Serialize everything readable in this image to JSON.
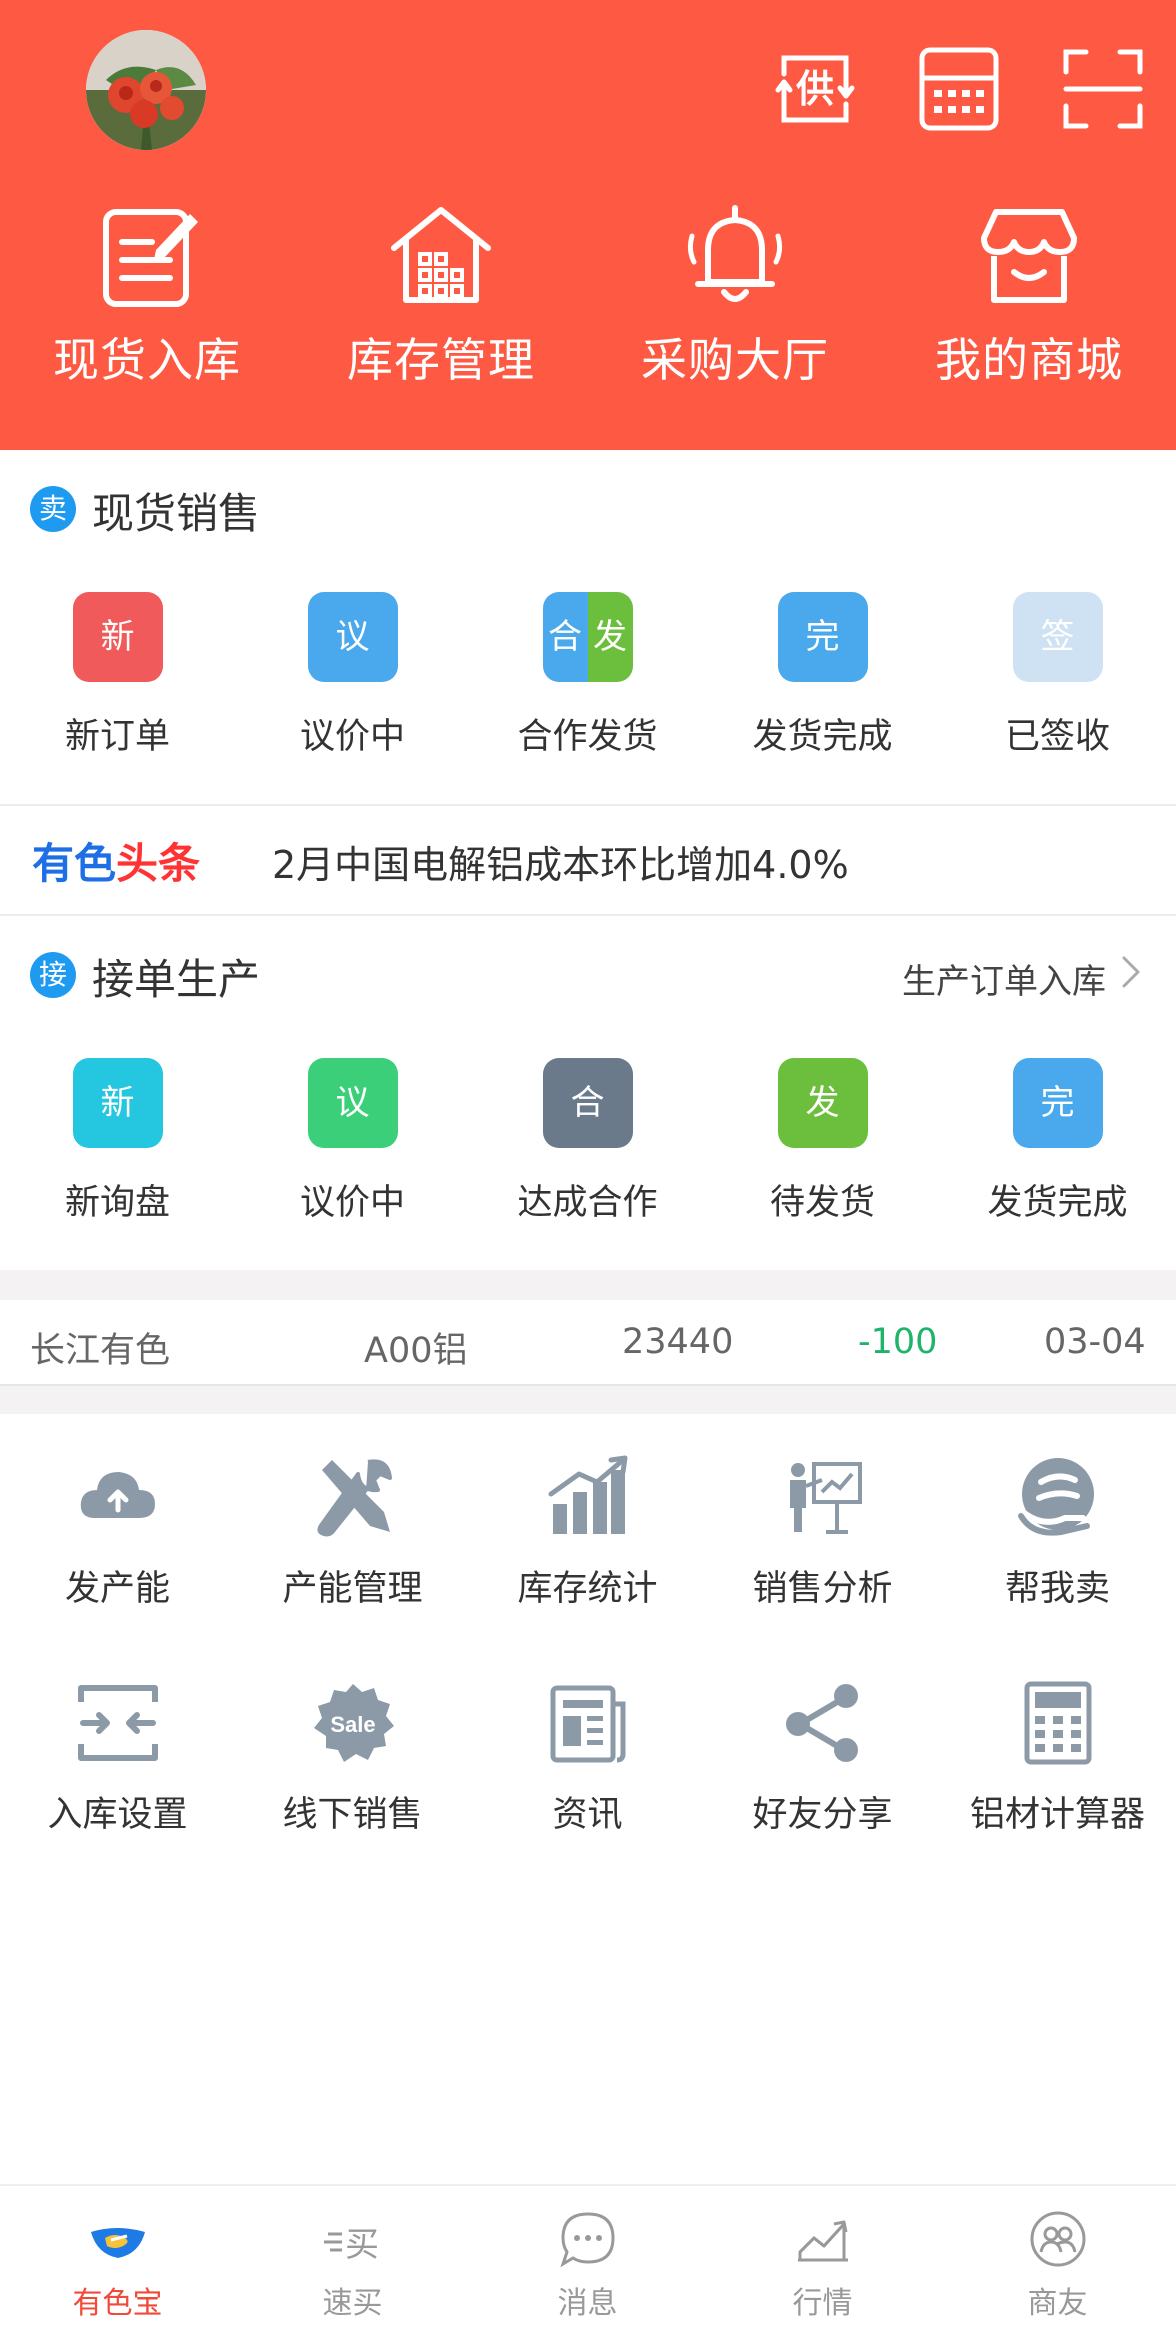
{
  "header": {
    "top_icons": [
      "supply-icon",
      "calculator-icon",
      "scan-icon"
    ],
    "supply_glyph": "供",
    "quick_actions": [
      {
        "label": "现货入库",
        "icon": "document-edit-icon"
      },
      {
        "label": "库存管理",
        "icon": "warehouse-icon"
      },
      {
        "label": "采购大厅",
        "icon": "bell-icon"
      },
      {
        "label": "我的商城",
        "icon": "store-icon"
      }
    ]
  },
  "spot_sales": {
    "badge": "卖",
    "title": "现货销售",
    "items": [
      {
        "icon_text": "新",
        "label": "新订单",
        "color": "#f05a5a"
      },
      {
        "icon_text": "议",
        "label": "议价中",
        "color": "#4aa8ec"
      },
      {
        "icon_text_left": "合",
        "icon_text_right": "发",
        "label": "合作发货",
        "color_left": "#4aa8ec",
        "color_right": "#6cbf3c"
      },
      {
        "icon_text": "完",
        "label": "发货完成",
        "color": "#4aa8ec"
      },
      {
        "icon_text": "签",
        "label": "已签收",
        "color": "#cfe2f3"
      }
    ]
  },
  "headline": {
    "brand_part1": "有色",
    "brand_part2": "头条",
    "text": "2月中国电解铝成本环比增加4.0%"
  },
  "order_production": {
    "badge": "接",
    "title": "接单生产",
    "link": "生产订单入库",
    "items": [
      {
        "icon_text": "新",
        "label": "新询盘",
        "color": "#24c6e0"
      },
      {
        "icon_text": "议",
        "label": "议价中",
        "color": "#3ccf7a"
      },
      {
        "icon_text": "合",
        "label": "达成合作",
        "color": "#6b7a8b"
      },
      {
        "icon_text": "发",
        "label": "待发货",
        "color": "#6cbf3c"
      },
      {
        "icon_text": "完",
        "label": "发货完成",
        "color": "#4aa8ec"
      }
    ]
  },
  "ticker": {
    "market": "长江有色",
    "product": "A00铝",
    "price": "23440",
    "change": "-100",
    "date": "03-04",
    "change_color": "#1fb46a"
  },
  "tools": [
    {
      "label": "发产能",
      "icon": "cloud-upload-icon"
    },
    {
      "label": "产能管理",
      "icon": "tools-icon"
    },
    {
      "label": "库存统计",
      "icon": "bar-chart-icon"
    },
    {
      "label": "销售分析",
      "icon": "presentation-icon"
    },
    {
      "label": "帮我卖",
      "icon": "help-sell-icon"
    },
    {
      "label": "入库设置",
      "icon": "inbound-settings-icon"
    },
    {
      "label": "线下销售",
      "icon": "sale-badge-icon",
      "badge_text": "Sale"
    },
    {
      "label": "资讯",
      "icon": "newspaper-icon"
    },
    {
      "label": "好友分享",
      "icon": "share-icon"
    },
    {
      "label": "铝材计算器",
      "icon": "calculator-icon"
    }
  ],
  "bottom_nav": [
    {
      "label": "有色宝",
      "icon": "handshake-icon",
      "active": true
    },
    {
      "label": "速买",
      "icon": "quick-buy-icon",
      "active": false,
      "icon_text": "买"
    },
    {
      "label": "消息",
      "icon": "message-icon",
      "active": false
    },
    {
      "label": "行情",
      "icon": "trend-icon",
      "active": false
    },
    {
      "label": "商友",
      "icon": "contacts-icon",
      "active": false
    }
  ],
  "colors": {
    "header_bg": "#fe5a43",
    "accent_blue": "#1e9bf0",
    "tool_icon": "#8c9aa8"
  }
}
